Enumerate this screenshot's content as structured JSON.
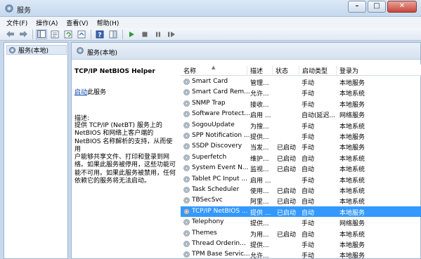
{
  "window": {
    "title": "服务"
  },
  "menu": [
    "文件(F)",
    "操作(A)",
    "查看(V)",
    "帮助(H)"
  ],
  "tree": {
    "item": "服务(本地)"
  },
  "pane": {
    "header": "服务(本地)"
  },
  "detail": {
    "service_title": "TCP/IP NetBIOS Helper",
    "start_link": "启动",
    "start_suffix": "此服务",
    "desc_label": "描述:",
    "desc_lines": [
      "提供 TCP/IP (NetBT) 服务上的",
      "NetBIOS 和网络上客户端的",
      "NetBIOS 名称解析的支持，从而使用",
      "户能够共享文件、打印和登录到网",
      "络。如果此服务被停用，这些功能可",
      "能不可用。如果此服务被禁用，任何",
      "依赖它的服务将无法启动。"
    ]
  },
  "columns": {
    "name": "名称",
    "desc": "描述",
    "status": "状态",
    "start": "启动类型",
    "logon": "登录为"
  },
  "rows": [
    {
      "name": "Smart Card",
      "desc": "管理...",
      "status": "",
      "start": "手动",
      "logon": "本地服务"
    },
    {
      "name": "Smart Card Rem...",
      "desc": "允许...",
      "status": "",
      "start": "手动",
      "logon": "本地系统"
    },
    {
      "name": "SNMP Trap",
      "desc": "接收...",
      "status": "",
      "start": "手动",
      "logon": "本地服务"
    },
    {
      "name": "Software Protect...",
      "desc": "启用 ...",
      "status": "",
      "start": "自动(延迟...",
      "logon": "网络服务"
    },
    {
      "name": "SogouUpdate",
      "desc": "为搜...",
      "status": "",
      "start": "手动",
      "logon": "本地系统"
    },
    {
      "name": "SPP Notification ...",
      "desc": "提供...",
      "status": "",
      "start": "手动",
      "logon": "本地服务"
    },
    {
      "name": "SSDP Discovery",
      "desc": "当发...",
      "status": "已启动",
      "start": "手动",
      "logon": "本地服务"
    },
    {
      "name": "Superfetch",
      "desc": "维护...",
      "status": "已启动",
      "start": "自动",
      "logon": "本地系统"
    },
    {
      "name": "System Event N...",
      "desc": "监视...",
      "status": "已启动",
      "start": "自动",
      "logon": "本地系统"
    },
    {
      "name": "Tablet PC Input ...",
      "desc": "启用 ...",
      "status": "",
      "start": "手动",
      "logon": "本地系统"
    },
    {
      "name": "Task Scheduler",
      "desc": "使用...",
      "status": "已启动",
      "start": "自动",
      "logon": "本地系统"
    },
    {
      "name": "TBSecSvc",
      "desc": "阿里...",
      "status": "已启动",
      "start": "自动",
      "logon": "本地系统"
    },
    {
      "name": "TCP/IP NetBIOS ...",
      "desc": "提供 ...",
      "status": "已启动",
      "start": "自动",
      "logon": "本地服务",
      "selected": true
    },
    {
      "name": "Telephony",
      "desc": "提供...",
      "status": "",
      "start": "手动",
      "logon": "网络服务"
    },
    {
      "name": "Themes",
      "desc": "为用...",
      "status": "已启动",
      "start": "自动",
      "logon": "本地系统"
    },
    {
      "name": "Thread Orderin...",
      "desc": "提供...",
      "status": "",
      "start": "手动",
      "logon": "本地服务"
    },
    {
      "name": "TPM Base Servic...",
      "desc": "允许...",
      "status": "",
      "start": "手动",
      "logon": "本地服务"
    }
  ],
  "colors": {
    "selection": "#3399ff",
    "link": "#0645ad",
    "frame": "#c7d8ec"
  },
  "icons": [
    "services-app-icon",
    "back-arrow-icon",
    "forward-arrow-icon",
    "console-tree-icon",
    "properties-icon",
    "refresh-icon",
    "export-list-icon",
    "help-icon",
    "show-hide-icon",
    "start-service-icon",
    "stop-service-icon",
    "pause-service-icon",
    "restart-service-icon",
    "gear-icon",
    "minimize-icon",
    "maximize-icon",
    "close-icon"
  ]
}
